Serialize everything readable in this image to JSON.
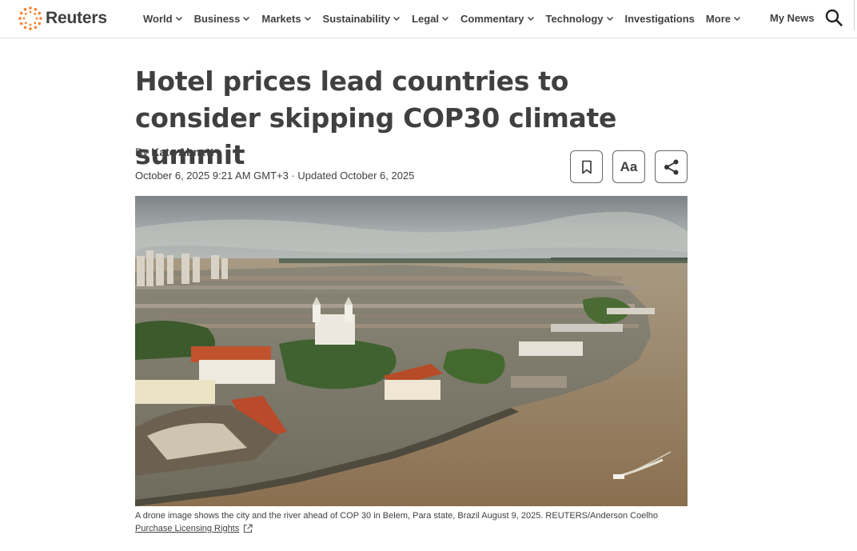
{
  "header": {
    "brand": "Reuters",
    "brand_color": "#fb8033",
    "nav": [
      {
        "label": "World",
        "has_dropdown": true
      },
      {
        "label": "Business",
        "has_dropdown": true
      },
      {
        "label": "Markets",
        "has_dropdown": true
      },
      {
        "label": "Sustainability",
        "has_dropdown": true
      },
      {
        "label": "Legal",
        "has_dropdown": true
      },
      {
        "label": "Commentary",
        "has_dropdown": true
      },
      {
        "label": "Technology",
        "has_dropdown": true
      },
      {
        "label": "Investigations",
        "has_dropdown": false
      },
      {
        "label": "More",
        "has_dropdown": true
      }
    ],
    "my_news": "My News",
    "search_icon": "search-icon"
  },
  "article": {
    "headline": "Hotel prices lead countries to consider skipping COP30 climate summit",
    "byline_prefix": "By",
    "author": "Kate Abnett",
    "dateline": "October 6, 2025 9:21 AM GMT+3 · Updated October 6, 2025",
    "tools": {
      "bookmark_icon": "bookmark-icon",
      "text_size_label": "Aa",
      "share_icon": "share-icon"
    },
    "image": {
      "caption": "A drone image shows the city and the river ahead of COP 30 in Belem, Para state, Brazil August 9, 2025. REUTERS/Anderson Coelho",
      "license_label": "Purchase Licensing Rights",
      "license_icon": "external-link-icon"
    }
  }
}
